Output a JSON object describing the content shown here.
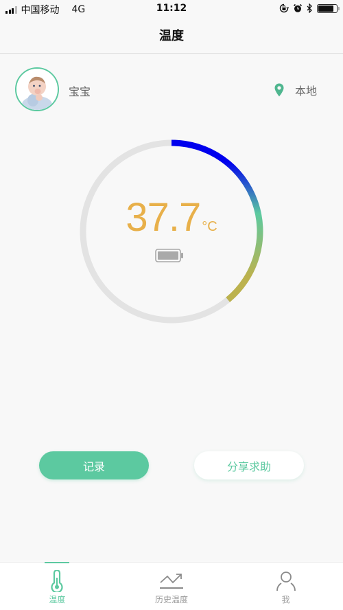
{
  "status_bar": {
    "carrier": "中国移动",
    "network": "4G",
    "time": "11:12",
    "signal_bars": 3,
    "signal_total": 4,
    "battery_level": 0.85,
    "icons": [
      "orientation-lock-icon",
      "alarm-icon",
      "bluetooth-icon",
      "battery-icon"
    ]
  },
  "header": {
    "title": "温度"
  },
  "profile": {
    "name": "宝宝",
    "avatar_icon": "baby-avatar",
    "location_icon": "location-pin-icon",
    "location": "本地"
  },
  "gauge": {
    "temperature": "37.7",
    "unit": "°C",
    "progress": 0.39,
    "gradient_colors": [
      "#0000ee",
      "#5ccaa0",
      "#bcb24e"
    ],
    "track_color": "#e3e3e3",
    "battery_icon": "device-battery-icon",
    "battery_level": 1.0
  },
  "actions": {
    "record_label": "记录",
    "share_label": "分享求助"
  },
  "tabs": [
    {
      "label": "温度",
      "icon": "thermometer-icon",
      "active": true
    },
    {
      "label": "历史温度",
      "icon": "trend-chart-icon",
      "active": false
    },
    {
      "label": "我",
      "icon": "person-icon",
      "active": false
    }
  ],
  "colors": {
    "accent": "#5cc9a0",
    "temperature_text": "#e8b04a"
  }
}
